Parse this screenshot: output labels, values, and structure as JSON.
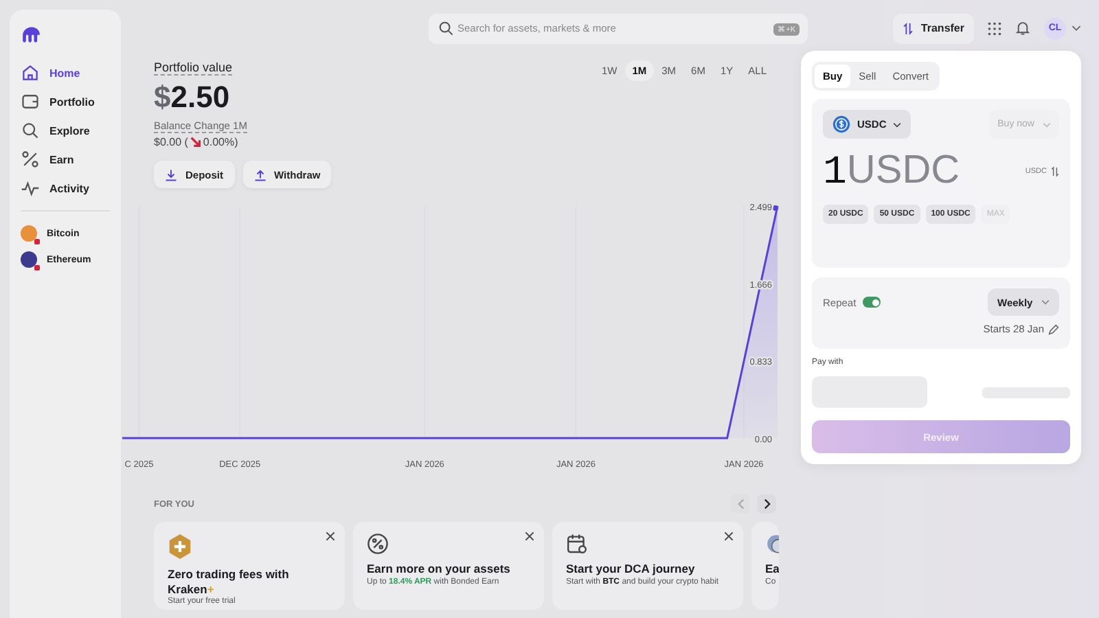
{
  "sidebar": {
    "items": [
      {
        "label": "Home",
        "selected": true
      },
      {
        "label": "Portfolio",
        "selected": false
      },
      {
        "label": "Explore",
        "selected": false
      },
      {
        "label": "Earn",
        "selected": false
      },
      {
        "label": "Activity",
        "selected": false
      }
    ],
    "assets": [
      {
        "label": "Bitcoin",
        "color": "#e8913a"
      },
      {
        "label": "Ethereum",
        "color": "#3b3a8f"
      }
    ]
  },
  "search": {
    "placeholder": "Search for assets, markets & more",
    "shortcut": "⌘+K"
  },
  "topbar": {
    "transfer": "Transfer",
    "avatar": "CL"
  },
  "portfolio": {
    "label": "Portfolio value",
    "currency": "$",
    "amount": "2.50",
    "change_label": "Balance Change 1M",
    "change_amount": "$0.00 (",
    "change_percent": "0.00%)",
    "actions": [
      "Deposit",
      "Withdraw"
    ],
    "periods": [
      {
        "label": "1W",
        "selected": false
      },
      {
        "label": "1M",
        "selected": true
      },
      {
        "label": "3M",
        "selected": false
      },
      {
        "label": "6M",
        "selected": false
      },
      {
        "label": "1Y",
        "selected": false
      },
      {
        "label": "ALL",
        "selected": false
      }
    ],
    "chart_data": {
      "type": "line",
      "categories": [
        null,
        "C 2025",
        null,
        null,
        null,
        null,
        null,
        "DEC 2025",
        null,
        null,
        null,
        null,
        null,
        null,
        null,
        null,
        null,
        null,
        "JAN 2026",
        null,
        null,
        null,
        null,
        null,
        null,
        null,
        null,
        "JAN 2026",
        null,
        null,
        null,
        null,
        null,
        null,
        null,
        null,
        null,
        "JAN 2026",
        null,
        null
      ],
      "series": [
        {
          "color": "#5b3fd9",
          "values": [
            0,
            0,
            0,
            0,
            0,
            0,
            0,
            0,
            0,
            0,
            0,
            0,
            0,
            0,
            0,
            0,
            0,
            0,
            0,
            0,
            0,
            0,
            0,
            0,
            0,
            0,
            0,
            0,
            0,
            0,
            0,
            0,
            0,
            0,
            0,
            0,
            0,
            0.83,
            1.67,
            2.5
          ]
        }
      ],
      "ylim": [
        0,
        2.5
      ],
      "grid": true,
      "yticks": [
        {
          "value": 0,
          "label": "0.00"
        },
        {
          "value": 0.833,
          "label": "0.833"
        },
        {
          "value": 1.666,
          "label": "1.666"
        },
        {
          "value": 2.499,
          "label": "2.499"
        }
      ]
    }
  },
  "for_you": {
    "title": "FOR YOU",
    "cards": [
      {
        "kind": "plus",
        "dismissible": true,
        "title": [
          {
            "text": "Zero trading fees with Kraken",
            "kind": "plain"
          },
          {
            "text": "+",
            "kind": "accent"
          }
        ],
        "subtitle": [
          {
            "text": "Start your free trial",
            "kind": "plain"
          }
        ]
      },
      {
        "kind": "percent",
        "dismissible": true,
        "title": [
          {
            "text": "Earn more on your assets",
            "kind": "plain"
          }
        ],
        "subtitle": [
          {
            "text": "Up to ",
            "kind": "plain"
          },
          {
            "text": "18.4% APR",
            "kind": "highlight"
          },
          {
            "text": " with Bonded Earn",
            "kind": "plain"
          }
        ]
      },
      {
        "kind": "calendar",
        "dismissible": true,
        "title": [
          {
            "text": "Start your DCA journey",
            "kind": "plain"
          }
        ],
        "subtitle": [
          {
            "text": "Start with ",
            "kind": "plain"
          },
          {
            "text": "BTC",
            "kind": "strong"
          },
          {
            "text": " and build your crypto habit",
            "kind": "plain"
          }
        ]
      },
      {
        "kind": "coin",
        "dismissible": false,
        "title": [
          {
            "text": "Ea",
            "kind": "plain"
          }
        ],
        "subtitle": [
          {
            "text": "Co",
            "kind": "plain"
          }
        ]
      }
    ]
  },
  "trade": {
    "tabs": [
      {
        "label": "Buy",
        "selected": true
      },
      {
        "label": "Sell",
        "selected": false
      },
      {
        "label": "Convert",
        "selected": false
      }
    ],
    "asset": "USDC",
    "order_type": "Buy now",
    "amount": "1",
    "amount_unit": "USDC",
    "unit_toggle": "USDC",
    "presets": [
      {
        "label": "20 USDC",
        "disabled": false
      },
      {
        "label": "50 USDC",
        "disabled": false
      },
      {
        "label": "100 USDC",
        "disabled": false
      },
      {
        "label": "MAX",
        "disabled": true
      }
    ],
    "repeat": {
      "label": "Repeat",
      "on": true,
      "frequency": "Weekly",
      "starts": "Starts 28 Jan"
    },
    "pay_with": "Pay with",
    "review": "Review"
  }
}
